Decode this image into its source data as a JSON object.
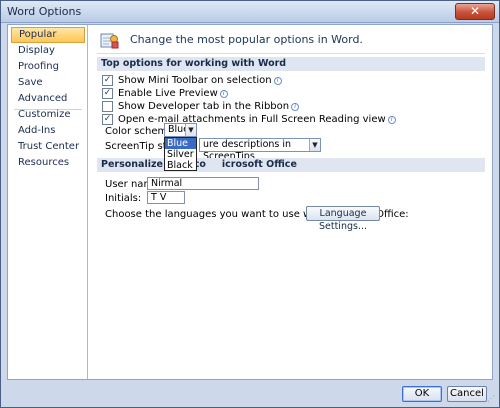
{
  "window": {
    "title": "Word Options",
    "close_glyph": "✕"
  },
  "sidebar": {
    "items": [
      {
        "label": "Popular",
        "selected": true
      },
      {
        "label": "Display"
      },
      {
        "label": "Proofing"
      },
      {
        "label": "Save"
      },
      {
        "label": "Advanced"
      },
      {
        "label": "Customize"
      },
      {
        "label": "Add-Ins"
      },
      {
        "label": "Trust Center"
      },
      {
        "label": "Resources"
      }
    ]
  },
  "header": {
    "text": "Change the most popular options in Word.",
    "icon": "options-icon"
  },
  "top_options": {
    "heading": "Top options for working with Word",
    "checkboxes": [
      {
        "label": "Show Mini Toolbar on selection",
        "checked": true,
        "info": true
      },
      {
        "label": "Enable Live Preview",
        "checked": true,
        "info": true
      },
      {
        "label": "Show Developer tab in the Ribbon",
        "checked": false,
        "info": true
      },
      {
        "label": "Open e-mail attachments in Full Screen Reading view",
        "checked": true,
        "info": true
      }
    ],
    "color_scheme": {
      "label": "Color scheme:",
      "value": "Blue",
      "options": [
        "Blue",
        "Silver",
        "Black"
      ],
      "highlighted": "Blue"
    },
    "screentip": {
      "label": "ScreenTip style:",
      "value": "ure descriptions in ScreenTips"
    }
  },
  "personalize": {
    "heading_left": "Personalize your co",
    "heading_right": "icrosoft Office",
    "user_name_label": "User name:",
    "user_name_value": "Nirmal",
    "initials_label": "Initials:",
    "initials_value": "T V",
    "language_text": "Choose the languages you want to use with Microsoft Office:",
    "language_button": "Language Settings..."
  },
  "footer": {
    "ok_label": "OK",
    "cancel_label": "Cancel"
  },
  "colors": {
    "accent": "#3a6bc4",
    "selected_tab": "#ffc653",
    "section_bg": "#dfe6f1"
  }
}
